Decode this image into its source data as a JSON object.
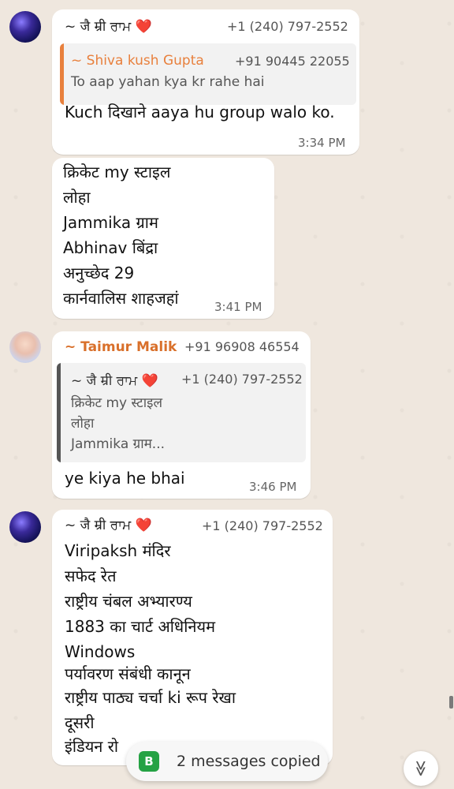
{
  "msg1": {
    "sender": "~ जै म्री ਰਾਮ",
    "heart": "❤️",
    "phone": "+1 (240) 797-2552",
    "quote": {
      "name": "~ Shiva kush Gupta",
      "phone": "+91 90445 22055",
      "text": "To aap yahan kya kr rahe hai",
      "bar_color": "#e8803d"
    },
    "text": "Kuch दिखाने aaya hu group walo ko.",
    "time": "3:34 PM"
  },
  "msg2": {
    "lines": [
      "क्रिकेट my स्टाइल",
      "लोहा",
      "Jammika ग्राम",
      "Abhinav बिंद्रा",
      "अनुच्छेद 29",
      "कार्नवालिस शाहजहां"
    ],
    "time": "3:41 PM"
  },
  "msg3": {
    "sender": "~ Taimur Malik",
    "phone": "+91 96908 46554",
    "quote": {
      "name": "~ जै म्री ਰਾਮ",
      "heart": "❤️",
      "phone": "+1 (240) 797-2552",
      "lines": [
        "क्रिकेट my स्टाइल",
        "लोहा",
        "Jammika ग्राम..."
      ],
      "bar_color": "#555555"
    },
    "text": "ye kiya he bhai",
    "time": "3:46 PM"
  },
  "msg4": {
    "sender": "~ जै म्री ਰਾਮ",
    "heart": "❤️",
    "phone": "+1 (240) 797-2552",
    "lines": [
      "Viripaksh मंदिर",
      "सफेद रेत",
      "राष्ट्रीय चंबल अभ्यारण्य",
      "1883 का चार्ट अधिनियम",
      "Windows",
      "पर्यावरण संबंधी कानून",
      "राष्ट्रीय पाठ्य चर्चा ki रूप रेखा",
      "दूसरी",
      "इंडियन रो"
    ]
  },
  "toast": {
    "icon_letter": "B",
    "text": "2 messages copied"
  },
  "scroll_down_icon": "≫"
}
